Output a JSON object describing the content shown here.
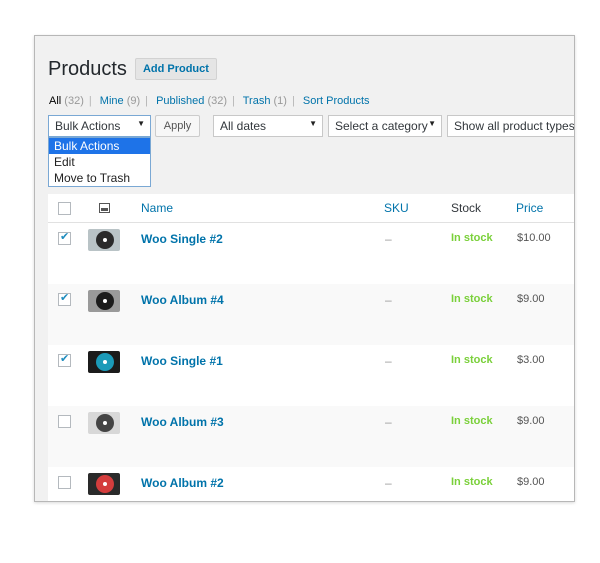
{
  "header": {
    "title": "Products",
    "add_button": "Add Product"
  },
  "views": [
    {
      "label": "All",
      "count": "(32)",
      "current": true
    },
    {
      "label": "Mine",
      "count": "(9)"
    },
    {
      "label": "Published",
      "count": "(32)"
    },
    {
      "label": "Trash",
      "count": "(1)"
    },
    {
      "label": "Sort Products",
      "count": ""
    }
  ],
  "tablenav": {
    "bulk_actions": "Bulk Actions",
    "apply": "Apply",
    "dates": "All dates",
    "category": "Select a category",
    "product_type": "Show all product types"
  },
  "bulk_dropdown": {
    "options": [
      "Bulk Actions",
      "Edit",
      "Move to Trash"
    ],
    "selected": "Bulk Actions"
  },
  "columns": {
    "name": "Name",
    "sku": "SKU",
    "stock": "Stock",
    "price": "Price"
  },
  "rows": [
    {
      "name": "Woo Single #2",
      "sku": "–",
      "stock": "In stock",
      "price": "$10.00",
      "checked": true,
      "disc": "#2a2a2a",
      "bg": "#b9c3c6"
    },
    {
      "name": "Woo Album #4",
      "sku": "–",
      "stock": "In stock",
      "price": "$9.00",
      "checked": true,
      "disc": "#1c1c1c",
      "bg": "#9a9a9a"
    },
    {
      "name": "Woo Single #1",
      "sku": "–",
      "stock": "In stock",
      "price": "$3.00",
      "checked": true,
      "disc": "#1b9ab8",
      "bg": "#1b1b1b"
    },
    {
      "name": "Woo Album #3",
      "sku": "–",
      "stock": "In stock",
      "price": "$9.00",
      "checked": false,
      "disc": "#444444",
      "bg": "#d8d8d8"
    },
    {
      "name": "Woo Album #2",
      "sku": "–",
      "stock": "In stock",
      "price": "$9.00",
      "checked": false,
      "disc": "#d43d3d",
      "bg": "#2a2a2a"
    }
  ],
  "colors": {
    "link": "#0073aa",
    "in_stock": "#7ad03a",
    "dropdown_highlight": "#1e73e8"
  }
}
